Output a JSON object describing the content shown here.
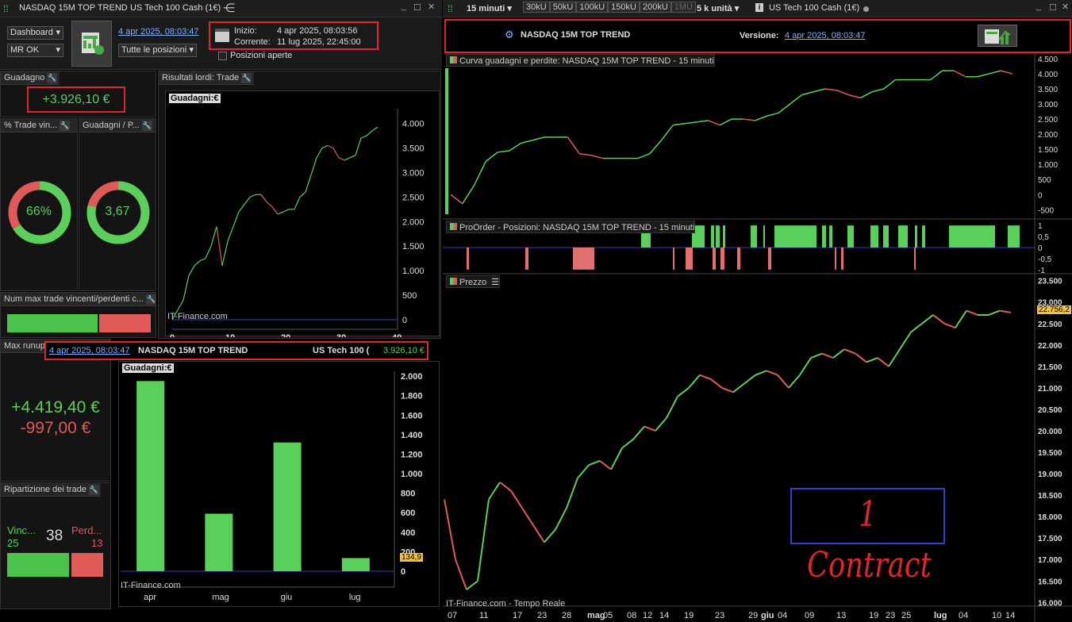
{
  "left": {
    "window_title": "NASDAQ 15M TOP TREND",
    "instrument": "US Tech 100 Cash (1€)",
    "dashboard_select": "Dashboard",
    "mr_select": "MR OK",
    "version_link": "4 apr 2025, 08:03:47",
    "positions_select": "Tutte le posizioni",
    "inizio_label": "Inizio:",
    "inizio_value": "4 apr 2025, 08:03:56",
    "corrente_label": "Corrente:",
    "corrente_value": "11 lug 2025, 22:45:00",
    "posizioni_aperte": "Posizioni aperte",
    "guadagno_label": "Guadagno",
    "guadagno_value": "+3.926,10 €",
    "trade_vinc_label": "% Trade vin...",
    "trade_vinc_value": "66%",
    "trade_vinc_fraction": 0.66,
    "guad_perd_label": "Guadagni / P...",
    "guad_perd_value": "3,67",
    "guad_perd_fraction": 0.786,
    "num_max_label": "Num max trade vincenti/perdenti c...",
    "max_runup_label": "Max runup",
    "max_runup_value": "+4.419,40 €",
    "max_drawdown_value": "-997,00 €",
    "ripartizione_label": "Ripartizione dei trade",
    "vinc_label": "Vinc...",
    "vinc_value": "25",
    "total_value": "38",
    "perd_label": "Perd...",
    "perd_value": "13",
    "risultati_label": "Risultati lordi: Trade",
    "guadagni_label": "Guadagni:€",
    "watermark": "IT-Finance.com",
    "banner_date": "4 apr 2025, 08:03:47",
    "banner_title": "NASDAQ 15M TOP TREND",
    "banner_instrument": "US Tech 100 (",
    "banner_value": "3.926,10 €",
    "bar_last_label": "134,9"
  },
  "right": {
    "timeframe": "15 minuti",
    "buttons": [
      "30kU",
      "50kU",
      "100kU",
      "150kU",
      "200kU",
      "1MU"
    ],
    "units": "5 k unità",
    "instrument": "US Tech 100 Cash (1€)",
    "strategy_name": "NASDAQ 15M TOP TREND",
    "version_label": "Versione:",
    "version_link": "4 apr 2025, 08:03:47",
    "curve_label": "Curva guadagni e perdite: NASDAQ 15M TOP TREND - 15 minuti",
    "proorder_label": "ProOrder - Posizioni: NASDAQ 15M TOP TREND - 15 minuti",
    "prezzo_label": "Prezzo",
    "price_tag": "22.756,2",
    "watermark": "IT-Finance.com - Tempo Reale",
    "contract_text": "1 Contract"
  },
  "colors": {
    "green": "#5ad05a",
    "red": "#e05a5a",
    "accent_red_box": "#e0262d",
    "blue_box": "#3240c8"
  },
  "chart_data": [
    {
      "type": "line",
      "title": "Guadagni:€",
      "x_ticks": [
        0,
        10,
        20,
        30,
        40
      ],
      "y_ticks": [
        0,
        500,
        1000,
        1500,
        2000,
        2500,
        3000,
        3500,
        4000
      ],
      "x": [
        0,
        2,
        3,
        4,
        5,
        6,
        7,
        8,
        9,
        10,
        11,
        12,
        13,
        14,
        15,
        16,
        17,
        18,
        19,
        20,
        21,
        22,
        23,
        24,
        25,
        26,
        27,
        28,
        29,
        30,
        31,
        32,
        33,
        34,
        35,
        36,
        37
      ],
      "y": [
        0,
        400,
        900,
        1100,
        1200,
        1250,
        1500,
        1900,
        1100,
        1600,
        1900,
        2200,
        2350,
        2500,
        2550,
        2550,
        2400,
        2300,
        2150,
        2200,
        2250,
        2250,
        2500,
        2600,
        2950,
        3300,
        3500,
        3550,
        3500,
        3300,
        3250,
        3300,
        3350,
        3700,
        3750,
        3850,
        3926
      ]
    },
    {
      "type": "bar",
      "title": "Guadagni:€",
      "categories": [
        "apr",
        "mag",
        "giu",
        "lug"
      ],
      "values": [
        1950,
        590,
        1320,
        134.9
      ],
      "y_ticks": [
        0,
        200,
        400,
        600,
        800,
        1000,
        1200,
        1400,
        1600,
        1800,
        2000
      ],
      "y_tick_labels": [
        "0",
        "200",
        "400",
        "600",
        "800",
        "1.000",
        "1.200",
        "1.400",
        "1.600",
        "1.800",
        "2.000"
      ]
    },
    {
      "type": "line",
      "title": "Curva guadagni e perdite: NASDAQ 15M TOP TREND - 15 minuti",
      "y_ticks": [
        -500,
        0,
        500,
        1000,
        1500,
        2000,
        2500,
        3000,
        3500,
        4000,
        4500
      ],
      "y_tick_labels": [
        "-500",
        "0",
        "500",
        "1.000",
        "1.500",
        "2.000",
        "2.500",
        "3.000",
        "3.500",
        "4.000",
        "4.500"
      ],
      "y": [
        0,
        -300,
        300,
        1100,
        1400,
        1450,
        1700,
        1800,
        1900,
        1900,
        1900,
        1350,
        1300,
        1200,
        1200,
        1200,
        1200,
        1350,
        1800,
        2300,
        2350,
        2400,
        2450,
        2300,
        2500,
        2500,
        2450,
        2600,
        2700,
        3000,
        3300,
        3400,
        3500,
        3450,
        3300,
        3200,
        3400,
        3500,
        3800,
        3800,
        3800,
        3800,
        4100,
        4100,
        3900,
        3900,
        4000,
        4100,
        4000
      ]
    },
    {
      "type": "area",
      "title": "ProOrder - Posizioni: NASDAQ 15M TOP TREND - 15 minuti",
      "y_ticks": [
        -1,
        -0.5,
        0,
        0.5,
        1
      ],
      "y_tick_labels": [
        "-1",
        "-0,5",
        "0",
        "0,5",
        "1"
      ]
    },
    {
      "type": "line",
      "title": "Prezzo",
      "y_ticks": [
        16000,
        16500,
        17000,
        17500,
        18000,
        18500,
        19000,
        19500,
        20000,
        20500,
        21000,
        21500,
        22000,
        22500,
        23000,
        23500
      ],
      "y_tick_labels": [
        "16.000",
        "16.500",
        "17.000",
        "17.500",
        "18.000",
        "18.500",
        "19.000",
        "19.500",
        "20.000",
        "20.500",
        "21.000",
        "21.500",
        "22.000",
        "22.500",
        "23.000",
        "23.500"
      ],
      "x_tick_labels": [
        "07",
        "11",
        "17",
        "23",
        "28",
        "mag",
        "05",
        "08",
        "12",
        "14",
        "19",
        "23",
        "29",
        "giu",
        "04",
        "09",
        "13",
        "19",
        "23",
        "25",
        "lug",
        "04",
        "10",
        "14"
      ],
      "y": [
        18400,
        17000,
        16300,
        16500,
        18400,
        18800,
        18600,
        18200,
        17800,
        17400,
        17700,
        18200,
        18900,
        19200,
        19300,
        19100,
        19600,
        19800,
        20100,
        20000,
        20300,
        20800,
        21000,
        21300,
        21200,
        21000,
        20900,
        21100,
        21300,
        21400,
        21300,
        21000,
        21300,
        21700,
        21800,
        21700,
        21900,
        21800,
        21600,
        21700,
        21500,
        21900,
        22300,
        22500,
        22700,
        22500,
        22400,
        22800,
        22700,
        22700,
        22800,
        22756
      ]
    }
  ]
}
